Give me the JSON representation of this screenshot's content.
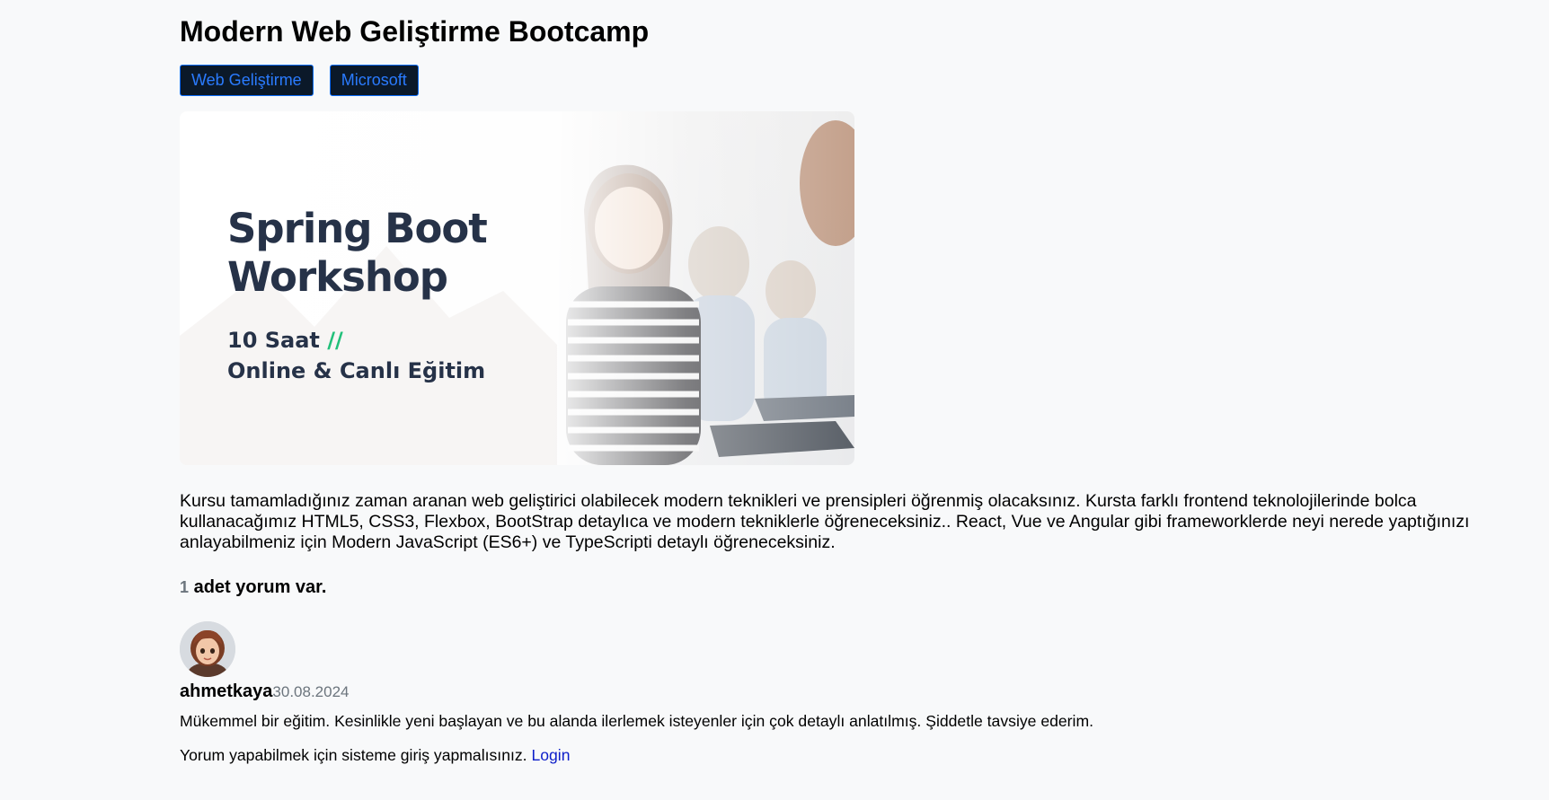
{
  "course": {
    "title": "Modern Web Geliştirme Bootcamp",
    "categories": [
      "Web Geliştirme",
      "Microsoft"
    ],
    "image": {
      "title": "Spring Boot\nWorkshop",
      "subtitle_prefix": "10 Saat",
      "subtitle_slash": "//",
      "subtitle_line2": "Online & Canlı Eğitim"
    },
    "description": "Kursu tamamladığınız zaman aranan web geliştirici olabilecek modern teknikleri ve prensipleri öğrenmiş olacaksınız. Kursta farklı frontend teknolojilerinde bolca kullanacağımız HTML5, CSS3, Flexbox, BootStrap detaylıca ve modern tekniklerle öğreneceksiniz.. React, Vue ve Angular gibi frameworklerde neyi nerede yaptığınızı anlayabilmeniz için Modern JavaScript (ES6+) ve TypeScripti detaylı öğreneceksiniz."
  },
  "comments": {
    "count": "1",
    "heading_suffix": " adet yorum var.",
    "items": [
      {
        "username": "ahmetkaya",
        "date": "30.08.2024",
        "text": "Mükemmel bir eğitim. Kesinlikle yeni başlayan ve bu alanda ilerlemek isteyenler için çok detaylı anlatılmış. Şiddetle tavsiye ederim."
      }
    ],
    "login_prompt": "Yorum yapabilmek için sisteme giriş yapmalısınız. ",
    "login_link": "Login"
  },
  "colors": {
    "tag_background": "#0b1929",
    "tag_border": "#0d6efd",
    "tag_text": "#2a7bff",
    "hero_text": "#263248",
    "hero_accent": "#22c07a",
    "link": "#0d1ec9",
    "muted": "#6c757d"
  },
  "icons": {
    "avatar": "user-avatar-cartoon"
  }
}
